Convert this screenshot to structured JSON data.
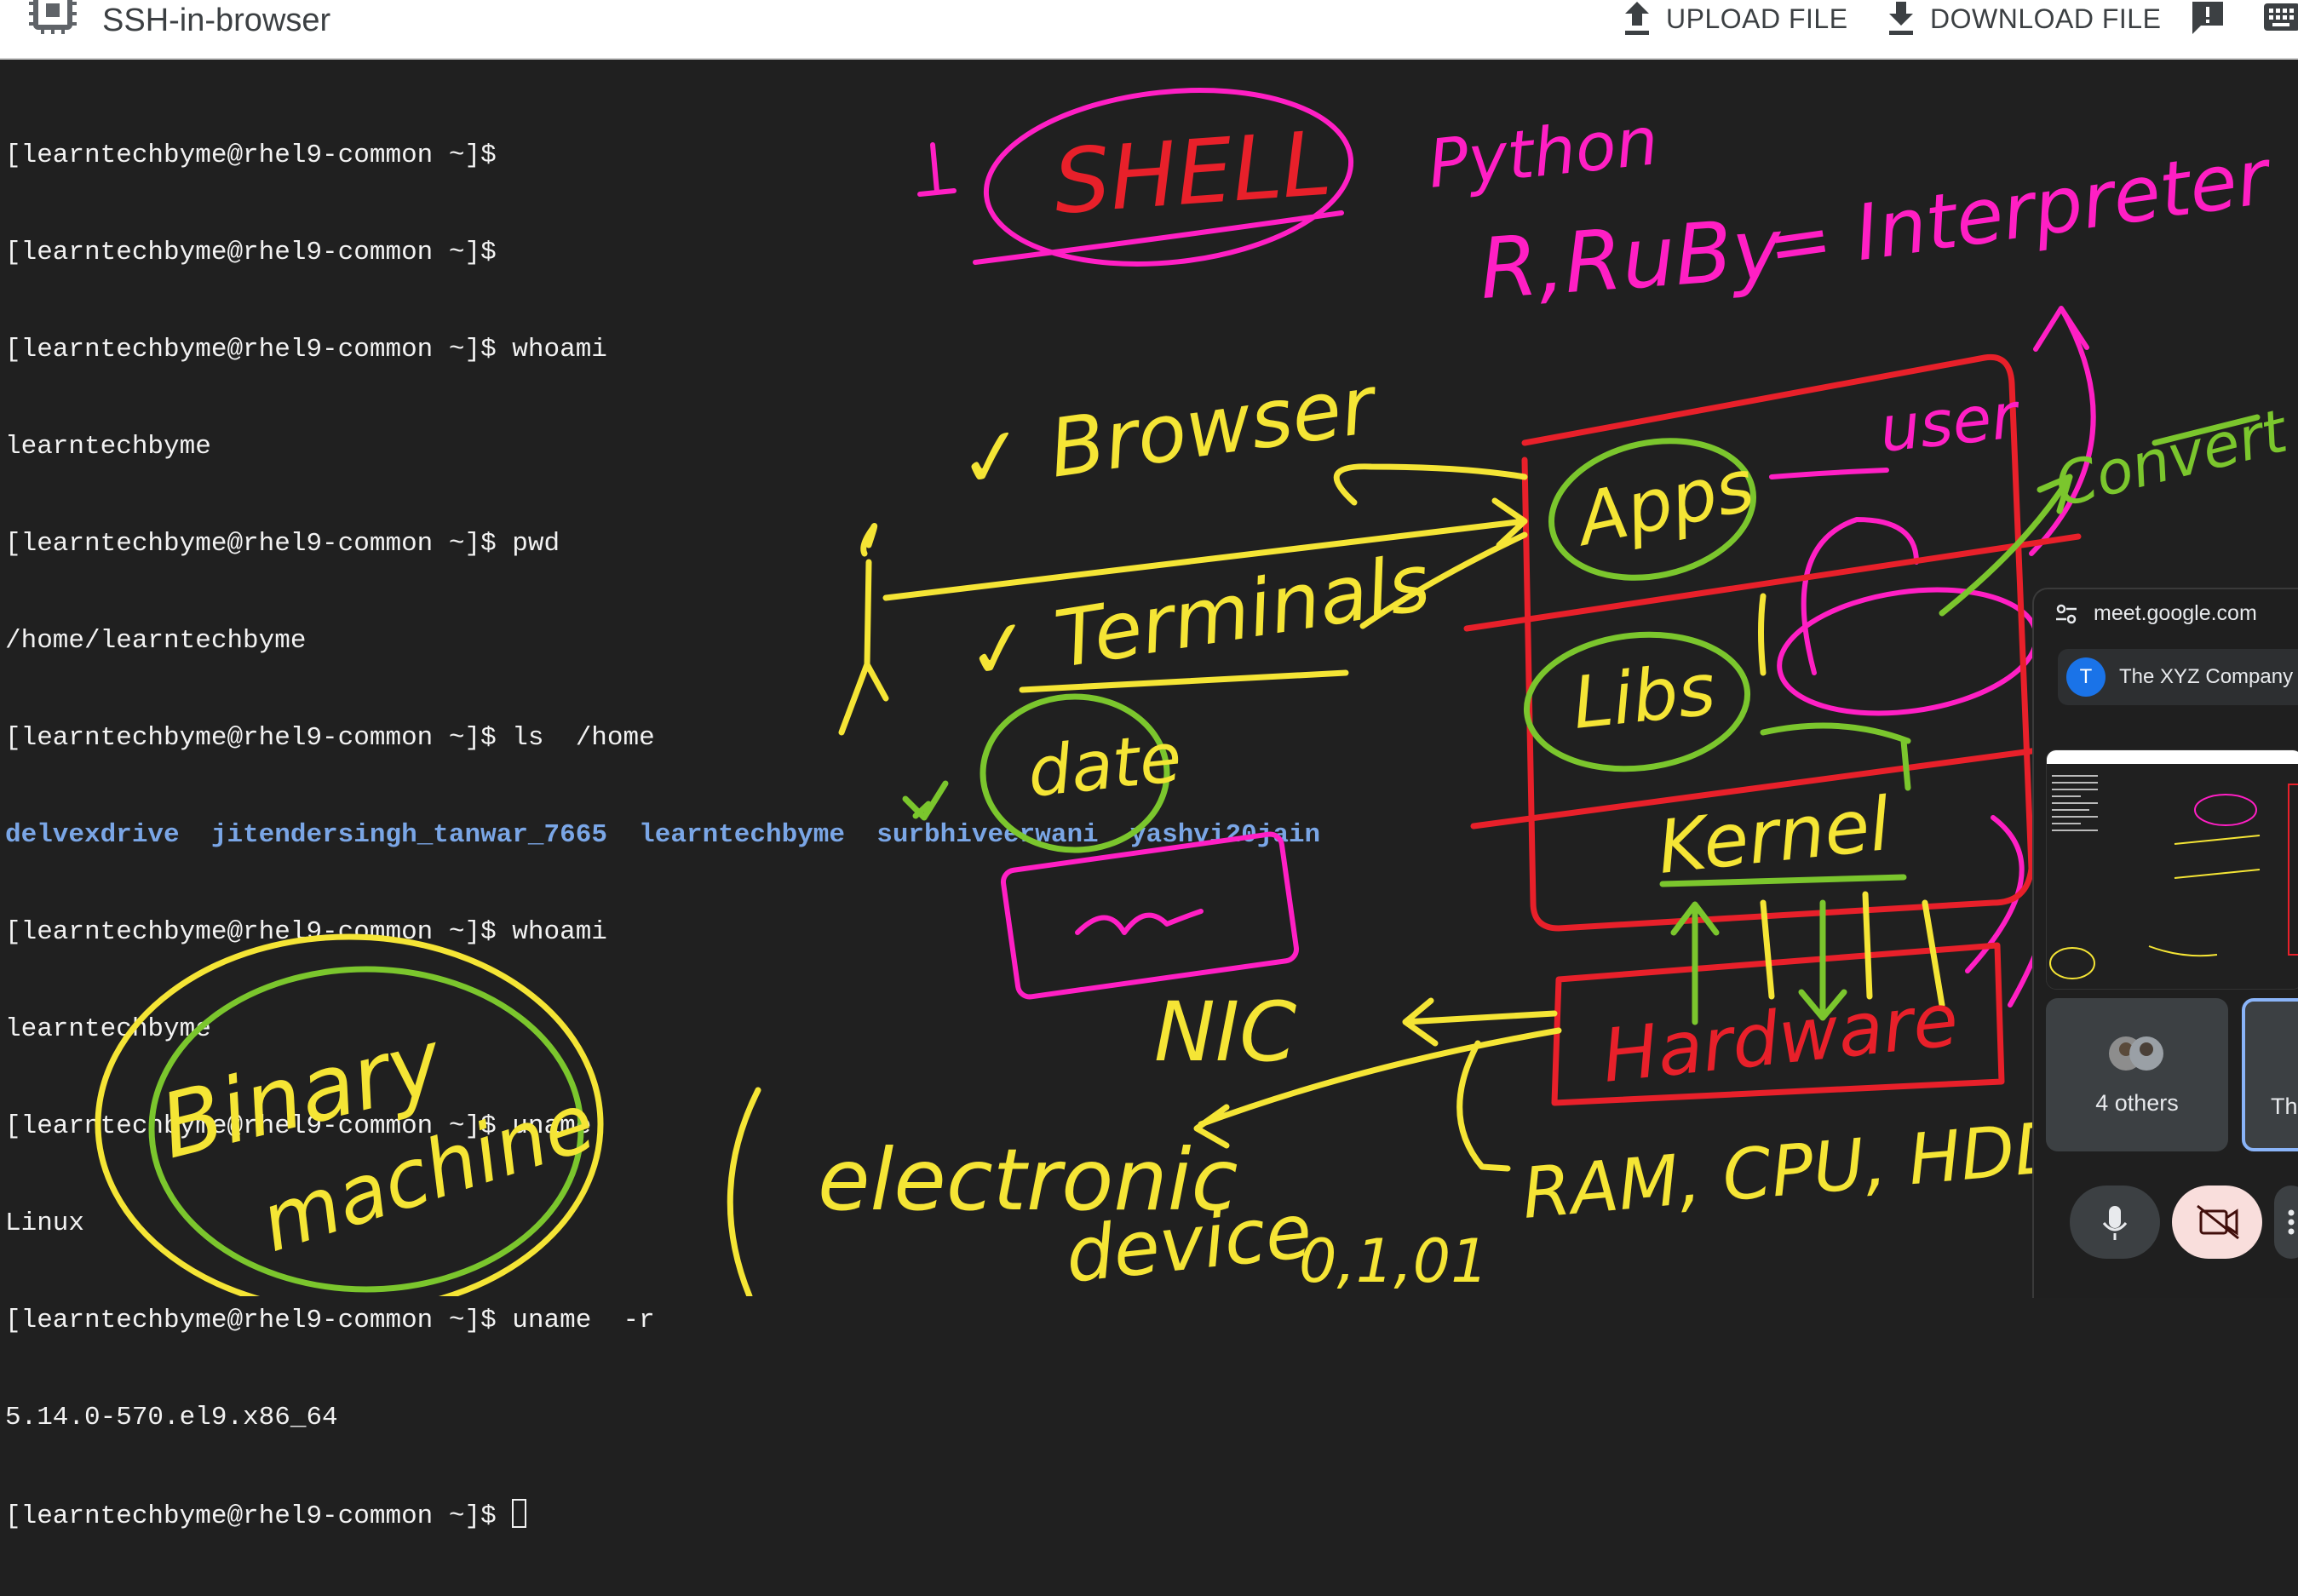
{
  "app": {
    "title": "SSH-in-browser"
  },
  "toolbar": {
    "upload_label": "UPLOAD FILE",
    "download_label": "DOWNLOAD FILE"
  },
  "terminal": {
    "lines": [
      "[learntechbyme@rhel9-common ~]$",
      "[learntechbyme@rhel9-common ~]$",
      "[learntechbyme@rhel9-common ~]$ whoami",
      "learntechbyme",
      "[learntechbyme@rhel9-common ~]$ pwd",
      "/home/learntechbyme",
      "[learntechbyme@rhel9-common ~]$ ls  /home",
      "",
      "[learntechbyme@rhel9-common ~]$ whoami",
      "learntechbyme",
      "[learntechbyme@rhel9-common ~]$ uname",
      "Linux",
      "[learntechbyme@rhel9-common ~]$ uname  -r",
      "5.14.0-570.el9.x86_64"
    ],
    "dirs": [
      "delvexdrive",
      "jitendersingh_tanwar_7665",
      "learntechbyme",
      "surbhiveerwani",
      "yashvi20jain"
    ],
    "prompt": "[learntechbyme@rhel9-common ~]$ "
  },
  "annotations": {
    "shell": "SHELL",
    "one": "1",
    "python": "Python",
    "r_ruby": "R,RuBy",
    "interpreter": "= Interpreter",
    "browser": "✓ Browser",
    "terminal": "✓ Terminals",
    "date": "date",
    "check": "✓",
    "apps": "Apps",
    "libs": "Libs",
    "user": "user",
    "convert": "Convert",
    "kernel": "Kernel",
    "hardware": "Hardware",
    "nic": "NIC",
    "ram": "RAM, CPU, HDD",
    "electronic": "electronic",
    "device": "device",
    "digits": "0,1,01",
    "binary": "Binary",
    "machine": "machine"
  },
  "meet": {
    "url": "meet.google.com",
    "company_initial": "T",
    "company": "The XYZ Company",
    "others": "4 others",
    "self_label": "Th"
  },
  "colors": {
    "yellow": "#f5e535",
    "pink": "#ff1fc4",
    "red": "#e8202a",
    "green": "#7bc62d",
    "terminal_bg": "#202020",
    "dir_blue": "#7aa6e6"
  }
}
